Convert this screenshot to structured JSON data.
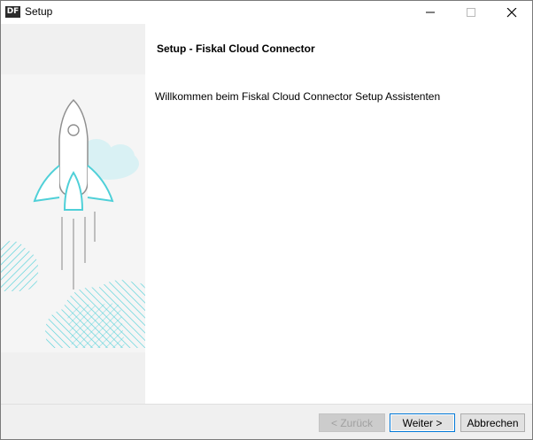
{
  "window": {
    "app_icon_text": "DF",
    "title": "Setup"
  },
  "content": {
    "heading": "Setup - Fiskal Cloud Connector",
    "welcome_text": "Willkommen beim Fiskal Cloud Connector Setup Assistenten"
  },
  "buttons": {
    "back": "< Zurück",
    "next": "Weiter >",
    "cancel": "Abbrechen"
  },
  "colors": {
    "accent_teal": "#4fd0d8",
    "cloud_light": "#cfeef2",
    "line_gray": "#9a9a9a"
  }
}
